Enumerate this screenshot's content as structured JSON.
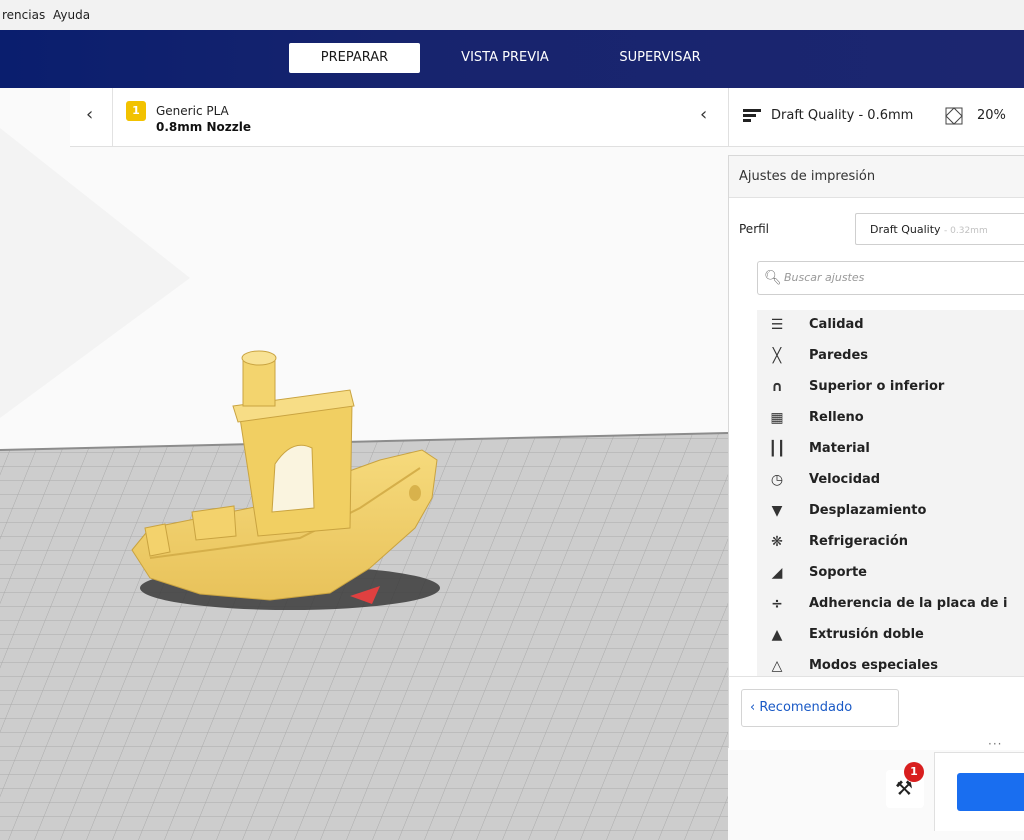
{
  "menubar": {
    "items": [
      "rencias",
      "Ayuda"
    ]
  },
  "stages": {
    "prepare": "PREPARAR",
    "preview": "VISTA PREVIA",
    "monitor": "SUPERVISAR"
  },
  "material": {
    "extruder_number": "1",
    "name": "Generic PLA",
    "nozzle": "0.8mm Nozzle"
  },
  "print_setup": {
    "quality": "Draft Quality - 0.6mm",
    "infill": "20%"
  },
  "panel": {
    "title": "Ajustes de impresión",
    "profile_label": "Perfil",
    "profile_name": "Draft Quality",
    "profile_detail": "- 0.32mm",
    "search_placeholder": "Buscar ajustes",
    "categories": [
      {
        "label": "Calidad",
        "icon": "quality-icon"
      },
      {
        "label": "Paredes",
        "icon": "walls-icon"
      },
      {
        "label": "Superior o inferior",
        "icon": "top-bottom-icon"
      },
      {
        "label": "Relleno",
        "icon": "infill-icon"
      },
      {
        "label": "Material",
        "icon": "material-icon"
      },
      {
        "label": "Velocidad",
        "icon": "speed-icon"
      },
      {
        "label": "Desplazamiento",
        "icon": "travel-icon"
      },
      {
        "label": "Refrigeración",
        "icon": "cooling-icon"
      },
      {
        "label": "Soporte",
        "icon": "support-icon"
      },
      {
        "label": "Adherencia de la placa de i",
        "icon": "adhesion-icon"
      },
      {
        "label": "Extrusión doble",
        "icon": "dual-extrusion-icon"
      },
      {
        "label": "Modos especiales",
        "icon": "special-modes-icon"
      }
    ],
    "recommended_label": "Recomendado"
  },
  "notifications": {
    "count": "1"
  },
  "colors": {
    "accent": "#196ef0",
    "header": "#131f6d",
    "model": "#f5d36a",
    "badge": "#d81e1e"
  }
}
